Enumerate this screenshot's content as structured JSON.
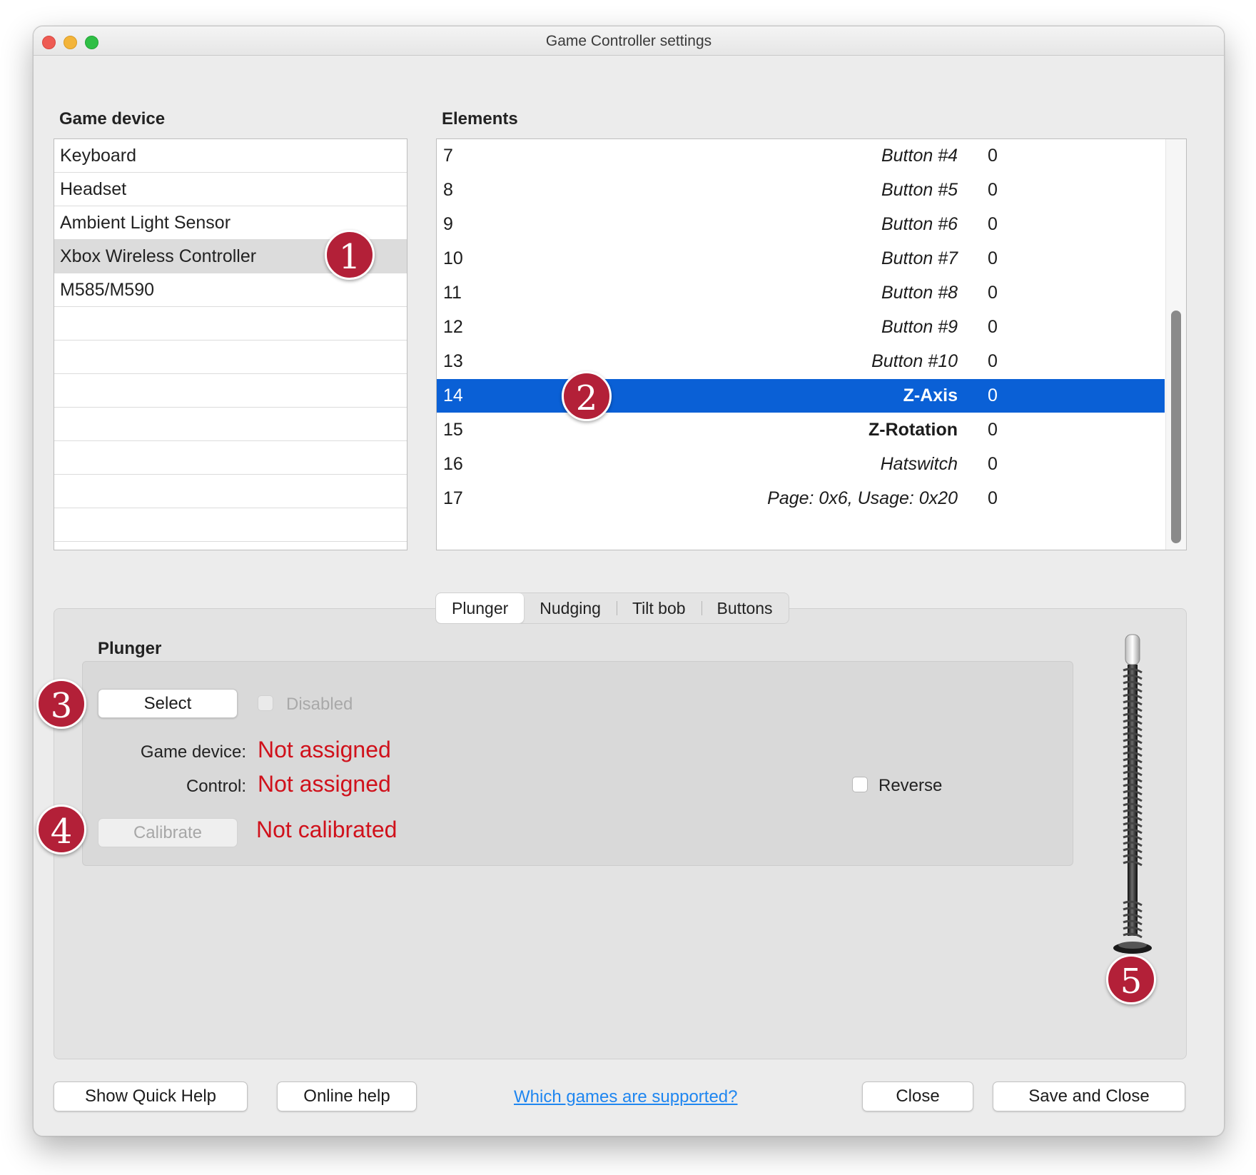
{
  "window": {
    "title": "Game Controller settings"
  },
  "devices": {
    "label": "Game device",
    "items": [
      "Keyboard",
      "Headset",
      "Ambient Light Sensor",
      "Xbox Wireless Controller",
      "M585/M590"
    ],
    "selected": "Xbox Wireless Controller"
  },
  "elements": {
    "label": "Elements",
    "rows": [
      {
        "num": "7",
        "name": "Button #4",
        "value": "0"
      },
      {
        "num": "8",
        "name": "Button #5",
        "value": "0"
      },
      {
        "num": "9",
        "name": "Button #6",
        "value": "0"
      },
      {
        "num": "10",
        "name": "Button #7",
        "value": "0"
      },
      {
        "num": "11",
        "name": "Button #8",
        "value": "0"
      },
      {
        "num": "12",
        "name": "Button #9",
        "value": "0"
      },
      {
        "num": "13",
        "name": "Button #10",
        "value": "0"
      },
      {
        "num": "14",
        "name": "Z-Axis",
        "value": "0"
      },
      {
        "num": "15",
        "name": "Z-Rotation",
        "value": "0"
      },
      {
        "num": "16",
        "name": "Hatswitch",
        "value": "0"
      },
      {
        "num": "17",
        "name": "Page: 0x6, Usage: 0x20",
        "value": "0"
      }
    ],
    "selected_num": "14"
  },
  "tabs": [
    "Plunger",
    "Nudging",
    "Tilt bob",
    "Buttons"
  ],
  "active_tab": "Plunger",
  "plunger": {
    "title": "Plunger",
    "select_label": "Select",
    "disabled_label": "Disabled",
    "game_device_label": "Game device:",
    "game_device_value": "Not assigned",
    "control_label": "Control:",
    "control_value": "Not assigned",
    "reverse_label": "Reverse",
    "calibrate_label": "Calibrate",
    "calibration_status": "Not calibrated"
  },
  "footer": {
    "quick_help": "Show Quick Help",
    "online_help": "Online help",
    "supported_link": "Which games are supported?",
    "close": "Close",
    "save_close": "Save and Close"
  },
  "badges": [
    "1",
    "2",
    "3",
    "4",
    "5"
  ],
  "colors": {
    "selection_blue": "#0a60d6",
    "status_red": "#d0111b",
    "badge_red": "#b32038",
    "link_blue": "#1f86f0"
  }
}
